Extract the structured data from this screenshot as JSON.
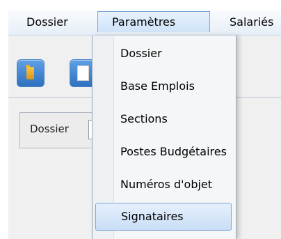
{
  "menubar": {
    "items": [
      {
        "label": "Dossier"
      },
      {
        "label": "Paramètres"
      },
      {
        "label": "Salariés"
      }
    ]
  },
  "toolbar": {
    "icons": [
      {
        "name": "folder-icon"
      },
      {
        "name": "document-icon"
      }
    ]
  },
  "form": {
    "dossier_label": "Dossier",
    "dossier_value": ""
  },
  "dropdown": {
    "items": [
      {
        "label": "Dossier"
      },
      {
        "label": "Base Emplois"
      },
      {
        "label": "Sections"
      },
      {
        "label": "Postes Budgétaires"
      },
      {
        "label": "Numéros d'objet"
      },
      {
        "label": "Signataires"
      }
    ],
    "highlighted": "Signataires"
  },
  "colors": {
    "menu_highlight": "#cfe3f8",
    "toolbar_button": "#2f70c0",
    "folder_icon": "#f5c542"
  }
}
